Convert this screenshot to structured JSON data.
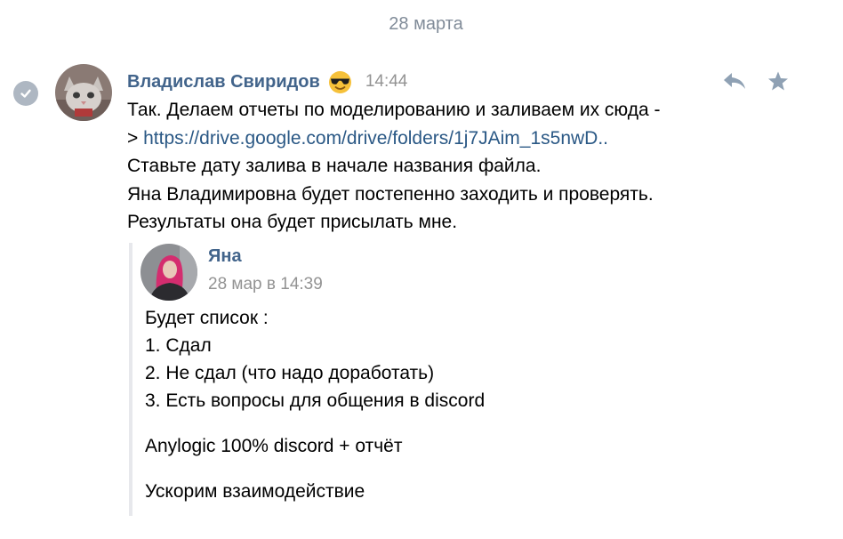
{
  "date_separator": "28 марта",
  "message": {
    "author": "Владислав Свиридов",
    "emoji": "sunglasses-emoji",
    "time": "14:44",
    "line1": "Так. Делаем отчеты по моделированию и заливаем их сюда -",
    "line2_prefix": "> ",
    "link": "https://drive.google.com/drive/folders/1j7JAim_1s5nwD..",
    "line3": "Ставьте дату залива в начале названия файла.",
    "line4": "Яна Владимировна будет постепенно заходить и проверять.",
    "line5": "Результаты она будет присылать мне."
  },
  "forwarded": {
    "author": "Яна",
    "date": "28 мар в 14:39",
    "lines": [
      "Будет список :",
      "1. Сдал",
      "2. Не сдал (что надо доработать)",
      "3. Есть вопросы для общения в discord"
    ],
    "line_anylogic": "Anylogic 100% discord + отчёт",
    "line_last": "Ускорим взаимодействие"
  },
  "icons": {
    "check": "check-circle-icon",
    "reply": "reply-icon",
    "star": "star-icon"
  },
  "colors": {
    "author_name": "#42648b",
    "link": "#2a5885",
    "secondary_text": "#939393",
    "date_separator": "#818c99",
    "quote_bar": "#e7e8ec",
    "check_circle": "#aeb7c2"
  }
}
